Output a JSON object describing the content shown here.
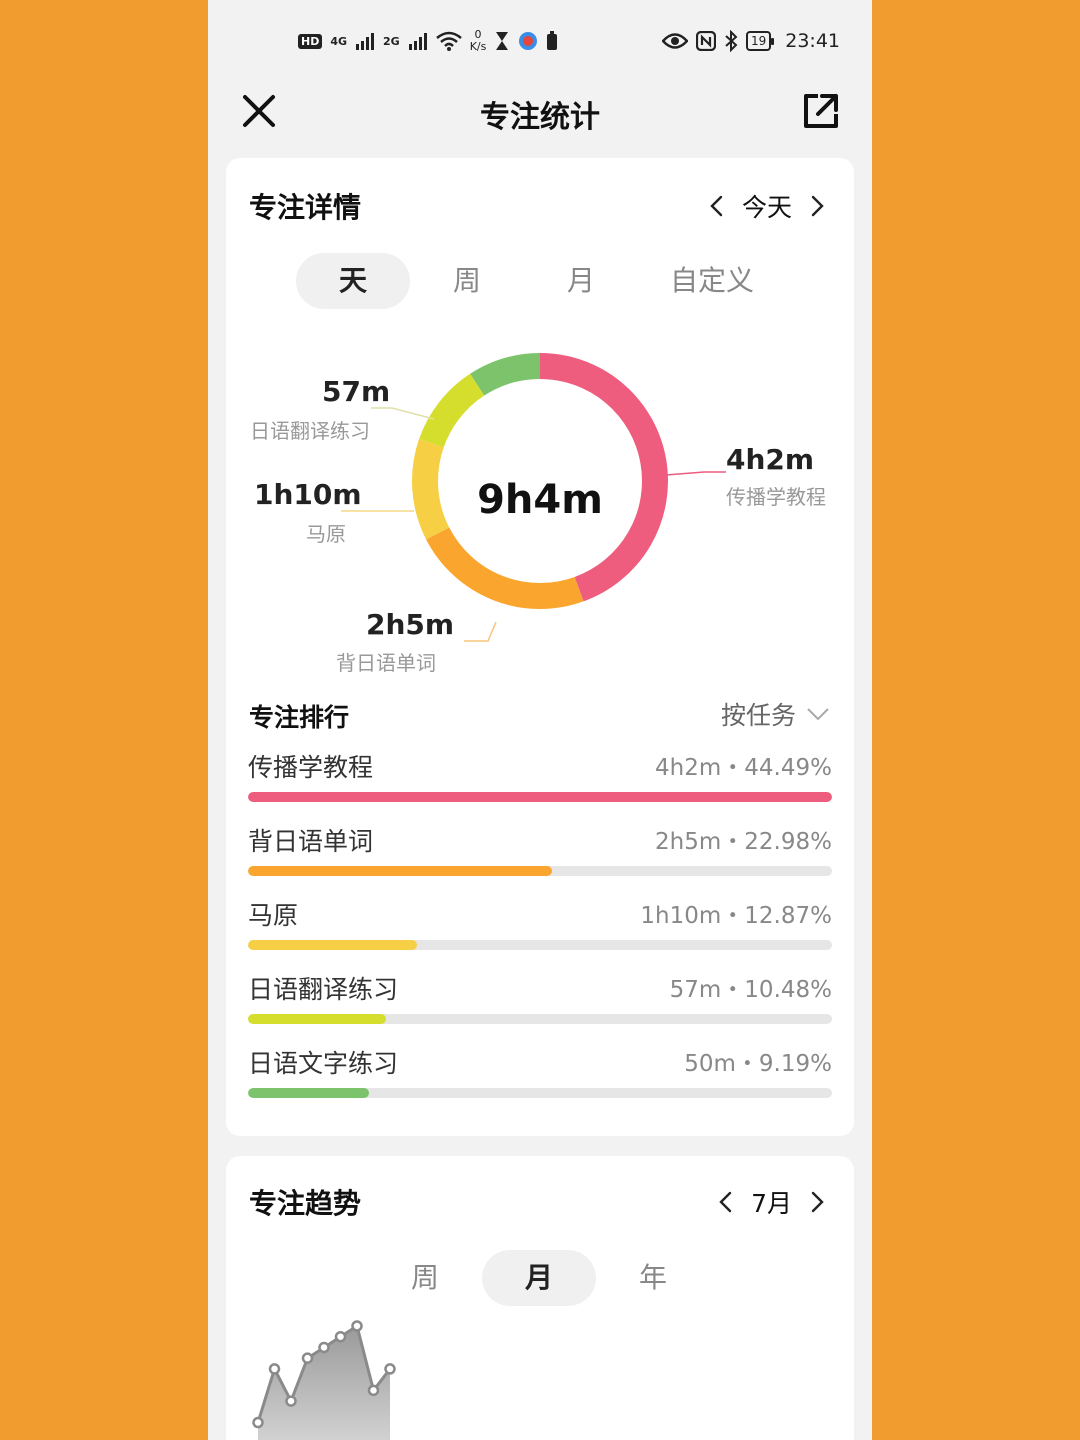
{
  "status_bar": {
    "hd": "HD",
    "sim1": "4G",
    "sim2": "2G",
    "speed_value": "0",
    "speed_unit": "K/s",
    "battery": "19",
    "time": "23:41"
  },
  "header": {
    "title": "专注统计"
  },
  "details": {
    "title": "专注详情",
    "date_label": "今天",
    "tabs": [
      "天",
      "周",
      "月",
      "自定义"
    ],
    "active_tab": 0,
    "total": "9h4m",
    "segments": [
      {
        "name": "传播学教程",
        "value": "4h2m",
        "minutes": 242,
        "color": "#EE5C7E"
      },
      {
        "name": "背日语单词",
        "value": "2h5m",
        "minutes": 125,
        "color": "#FAA62E"
      },
      {
        "name": "马原",
        "value": "1h10m",
        "minutes": 70,
        "color": "#F6CF45"
      },
      {
        "name": "日语翻译练习",
        "value": "57m",
        "minutes": 57,
        "color": "#D5DE2C"
      },
      {
        "name": "日语文字练习",
        "value": "",
        "minutes": 50,
        "color": "#7CC36C"
      }
    ]
  },
  "ranking": {
    "title": "专注排行",
    "sort_label": "按任务",
    "items": [
      {
        "name": "传播学教程",
        "stat": "4h2m・44.49%",
        "ratio": 1.0,
        "color": "#EE5C7E"
      },
      {
        "name": "背日语单词",
        "stat": "2h5m・22.98%",
        "ratio": 0.52,
        "color": "#FAA62E"
      },
      {
        "name": "马原",
        "stat": "1h10m・12.87%",
        "ratio": 0.29,
        "color": "#F6CF45"
      },
      {
        "name": "日语翻译练习",
        "stat": "57m・10.48%",
        "ratio": 0.236,
        "color": "#D5DE2C"
      },
      {
        "name": "日语文字练习",
        "stat": "50m・9.19%",
        "ratio": 0.207,
        "color": "#7CC36C"
      }
    ]
  },
  "trend": {
    "title": "专注趋势",
    "date_label": "7月",
    "tabs": [
      "周",
      "月",
      "年"
    ],
    "active_tab": 1,
    "chart_data": {
      "type": "area",
      "title": "",
      "xlabel": "",
      "ylabel": "",
      "series": [
        {
          "values": [
            2,
            7,
            4,
            8,
            9,
            10,
            11,
            5,
            7
          ]
        }
      ]
    }
  }
}
